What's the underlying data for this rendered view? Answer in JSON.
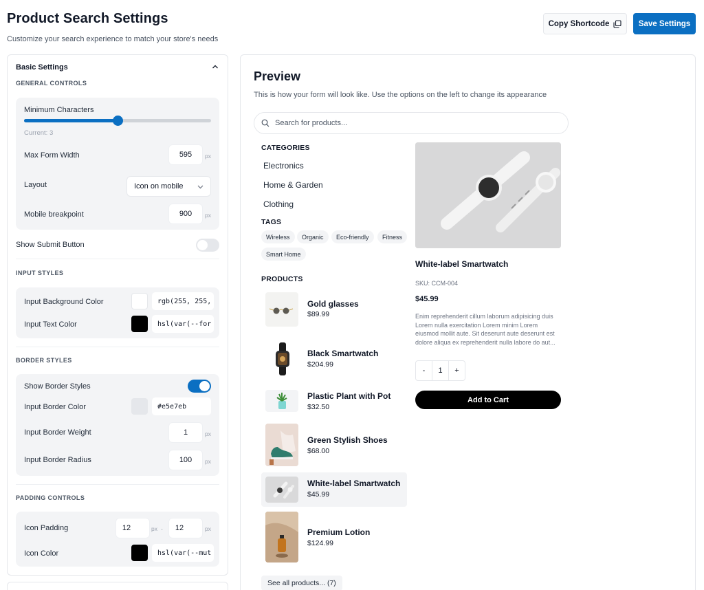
{
  "header": {
    "title": "Product Search Settings",
    "subtitle": "Customize your search experience to match your store's needs",
    "copy_label": "Copy Shortcode",
    "save_label": "Save Settings"
  },
  "settings": {
    "section_title": "Basic Settings",
    "general_label": "GENERAL CONTROLS",
    "min_chars_label": "Minimum Characters",
    "min_chars_current": "Current: 3",
    "min_chars_fraction": 0.5,
    "max_width_label": "Max Form Width",
    "max_width_value": "595",
    "layout_label": "Layout",
    "layout_value": "Icon on mobile",
    "breakpoint_label": "Mobile breakpoint",
    "breakpoint_value": "900",
    "unit_px": "px",
    "show_submit_label": "Show Submit Button",
    "show_submit_on": false,
    "input_styles_label": "INPUT STYLES",
    "input_bg_label": "Input Background Color",
    "input_bg_value": "rgb(255, 255,",
    "input_bg_swatch": "#ffffff",
    "input_text_label": "Input Text Color",
    "input_text_value": "hsl(var(--for",
    "input_text_swatch": "#000000",
    "border_styles_label": "BORDER STYLES",
    "show_border_label": "Show Border Styles",
    "show_border_on": true,
    "border_color_label": "Input Border Color",
    "border_color_value": "#e5e7eb",
    "border_color_swatch": "#e5e7eb",
    "border_weight_label": "Input Border Weight",
    "border_weight_value": "1",
    "border_radius_label": "Input Border Radius",
    "border_radius_value": "100",
    "padding_label": "PADDING CONTROLS",
    "icon_padding_label": "Icon Padding",
    "icon_padding_a": "12",
    "icon_padding_b": "12",
    "separator": "-",
    "icon_color_label": "Icon Color",
    "icon_color_value": "hsl(var(--mut",
    "icon_color_swatch": "#000000"
  },
  "preview": {
    "title": "Preview",
    "subtitle": "This is how your form will look like. Use the options on the left to change its appearance",
    "search_placeholder": "Search for products...",
    "categories_label": "CATEGORIES",
    "categories": [
      "Electronics",
      "Home & Garden",
      "Clothing"
    ],
    "tags_label": "TAGS",
    "tags": [
      "Wireless",
      "Organic",
      "Eco-friendly",
      "Fitness",
      "Smart Home"
    ],
    "products_label": "PRODUCTS",
    "products": [
      {
        "name": "Gold glasses",
        "price": "$89.99"
      },
      {
        "name": "Black Smartwatch",
        "price": "$204.99"
      },
      {
        "name": "Plastic Plant with Pot",
        "price": "$32.50"
      },
      {
        "name": "Green Stylish Shoes",
        "price": "$68.00"
      },
      {
        "name": "White-label Smartwatch",
        "price": "$45.99"
      },
      {
        "name": "Premium Lotion",
        "price": "$124.99"
      }
    ],
    "see_all": "See all products... (7)",
    "detail": {
      "name": "White-label Smartwatch",
      "sku": "SKU: CCM-004",
      "price": "$45.99",
      "description": "Enim reprehenderit cillum laborum adipisicing duis Lorem nulla exercitation Lorem minim Lorem eiusmod mollit aute. Sit deserunt aute deserunt est dolore aliqua ex reprehenderit nulla labore do aut...",
      "qty_minus": "-",
      "qty_value": "1",
      "qty_plus": "+",
      "add_to_cart": "Add to Cart"
    }
  },
  "colors": {
    "accent": "#0b6fc2",
    "toggle_off": "#e5e7eb"
  }
}
